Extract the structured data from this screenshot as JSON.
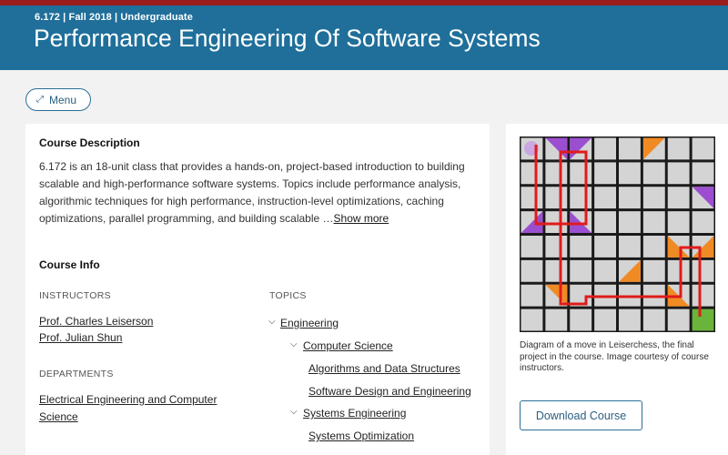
{
  "header": {
    "meta": "6.172 | Fall 2018 | Undergraduate",
    "title": "Performance Engineering Of Software Systems"
  },
  "menu": {
    "label": "Menu",
    "icon": "expand-arrows-icon"
  },
  "description": {
    "heading": "Course Description",
    "lines": [
      "6.172 is an 18-unit class that provides a hands-on, project-based introduction to building",
      "scalable and high-performance software systems. Topics include performance analysis,",
      "algorithmic techniques for high performance, instruction-level optimizations, caching",
      "optimizations, parallel programming, and building scalable …"
    ],
    "show_more": "Show more"
  },
  "course_info": {
    "heading": "Course Info",
    "instructors_label": "INSTRUCTORS",
    "instructors": [
      "Prof. Charles Leiserson",
      "Prof. Julian Shun"
    ],
    "departments_label": "DEPARTMENTS",
    "departments": [
      "Electrical Engineering and Computer",
      "Science"
    ],
    "topics_label": "TOPICS",
    "topics": {
      "engineering": "Engineering",
      "computer_science": "Computer Science",
      "algorithms": "Algorithms and Data Structures",
      "software_design": "Software Design and Engineering",
      "systems_engineering": "Systems Engineering",
      "systems_optimization": "Systems Optimization"
    }
  },
  "sidebar": {
    "caption": "Diagram of a move in Leiserchess, the final project in the course. Image courtesy of course instructors.",
    "download_label": "Download Course"
  },
  "colors": {
    "header_bg": "#1f6f9a",
    "top_stripe": "#9b1c1f",
    "purple_piece": "#9b4fd0",
    "orange_piece": "#f08a24",
    "laser": "#e01b1b",
    "green_square": "#6ab43b"
  }
}
